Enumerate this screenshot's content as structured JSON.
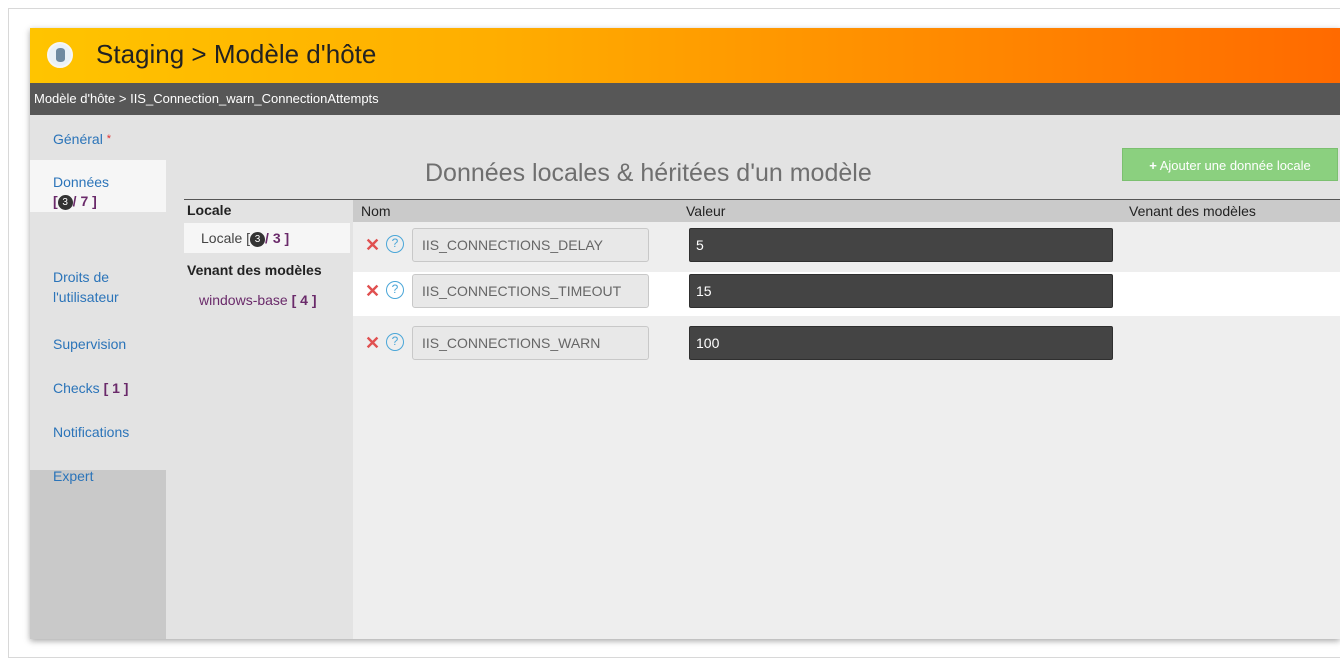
{
  "window": {
    "title": "Staging > Modèle d'hôte",
    "breadcrumb": "Modèle d'hôte > IIS_Connection_warn_ConnectionAttempts"
  },
  "sidebar": {
    "items": [
      {
        "label": "Général",
        "required": "*"
      },
      {
        "label": "Données",
        "bubble": "3",
        "count": "/ 7 ]",
        "open": "["
      },
      {
        "label": "Droits de l'utilisateur"
      },
      {
        "label": "Supervision"
      },
      {
        "label": "Checks",
        "count": "[ 1 ]"
      },
      {
        "label": "Notifications"
      },
      {
        "label": "Expert"
      }
    ]
  },
  "content": {
    "heading": "Données locales & héritées d'un modèle",
    "add_button": "Ajouter une donnée locale",
    "subnav": {
      "locale_title": "Locale",
      "locale_item": "Locale [",
      "locale_bubble": "3",
      "locale_count": "/ 3 ]",
      "inherited_title": "Venant des modèles",
      "inherited_item": "windows-base",
      "inherited_count": "[ 4 ]"
    },
    "columns": {
      "name": "Nom",
      "value": "Valeur",
      "origin": "Venant des modèles"
    },
    "rows": [
      {
        "name": "IIS_CONNECTIONS_DELAY",
        "value": "5"
      },
      {
        "name": "IIS_CONNECTIONS_TIMEOUT",
        "value": "15"
      },
      {
        "name": "IIS_CONNECTIONS_WARN",
        "value": "100"
      }
    ]
  },
  "colors": {
    "title_gradient_start": "#ffc400",
    "title_gradient_end": "#ff6a00",
    "link": "#2b74b9",
    "count": "#6a2a6a",
    "add_button": "#8bd07f"
  }
}
